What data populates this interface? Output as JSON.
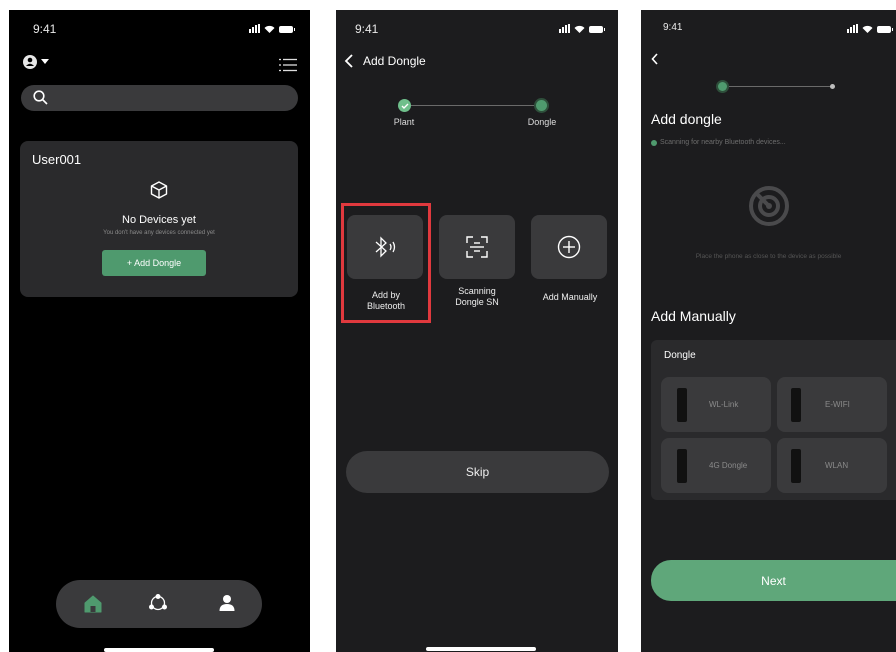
{
  "screen1": {
    "time": "9:41",
    "card_title": "User001",
    "empty_title": "No Devices yet",
    "empty_sub": "You don't have any devices connected yet",
    "add_button": "+ Add Dongle"
  },
  "screen2": {
    "time": "9:41",
    "title": "Add Dongle",
    "steps": [
      "Plant",
      "Dongle"
    ],
    "options": [
      {
        "label_line1": "Add by",
        "label_line2": "Bluetooth",
        "icon": "bluetooth-icon"
      },
      {
        "label_line1": "Scanning",
        "label_line2": "Dongle SN",
        "icon": "scan-icon"
      },
      {
        "label_line1": "Add Manually",
        "label_line2": "",
        "icon": "plus-circle-icon"
      }
    ],
    "skip": "Skip",
    "highlight_color": "#e0393e"
  },
  "screen3": {
    "time": "9:41",
    "title": "Add dongle",
    "scanning": "Scanning for nearby Bluetooth devices...",
    "hint": "Place the phone as close to the device as possible",
    "manual_title": "Add Manually",
    "group_title": "Dongle",
    "devices": [
      "WL-Link",
      "E-WIFI",
      "4G Dongle",
      "WLAN"
    ],
    "next": "Next"
  },
  "colors": {
    "accent": "#4f9a6e",
    "card": "#2a2a2c",
    "tile": "#3a3a3c"
  }
}
